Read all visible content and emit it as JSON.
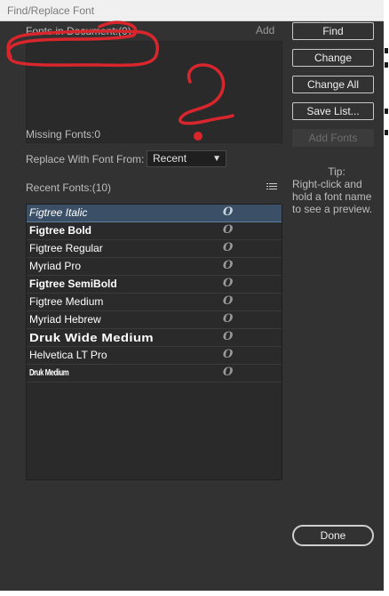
{
  "window": {
    "title": "Find/Replace Font"
  },
  "fonts_in_document": {
    "label": "Fonts in Document:(0)",
    "add_label": "Add"
  },
  "buttons": {
    "find": "Find",
    "change": "Change",
    "change_all": "Change All",
    "save_list": "Save List...",
    "add_fonts": "Add Fonts",
    "done": "Done"
  },
  "missing_fonts": "Missing Fonts:0",
  "replace_with": {
    "label": "Replace With Font From:",
    "selected": "Recent"
  },
  "recent_fonts": {
    "label": "Recent Fonts:(10)",
    "items": [
      {
        "name": "Figtree Italic",
        "type_icon": "opentype-icon",
        "selected": true
      },
      {
        "name": "Figtree Bold",
        "type_icon": "opentype-icon"
      },
      {
        "name": "Figtree Regular",
        "type_icon": "opentype-icon"
      },
      {
        "name": "Myriad Pro",
        "type_icon": "opentype-icon"
      },
      {
        "name": "Figtree SemiBold",
        "type_icon": "opentype-icon"
      },
      {
        "name": "Figtree Medium",
        "type_icon": "opentype-icon"
      },
      {
        "name": "Myriad Hebrew",
        "type_icon": "opentype-icon"
      },
      {
        "name": "Druk Wide Medium",
        "type_icon": "opentype-icon"
      },
      {
        "name": "Helvetica LT Pro",
        "type_icon": "opentype-icon"
      },
      {
        "name": "Druk Medium",
        "type_icon": "opentype-icon"
      }
    ]
  },
  "tip": {
    "heading": "Tip:",
    "text": "Right-click and hold a font name to see a preview."
  },
  "colors": {
    "annotation": "#d9262c",
    "selection": "#3b4f66"
  }
}
